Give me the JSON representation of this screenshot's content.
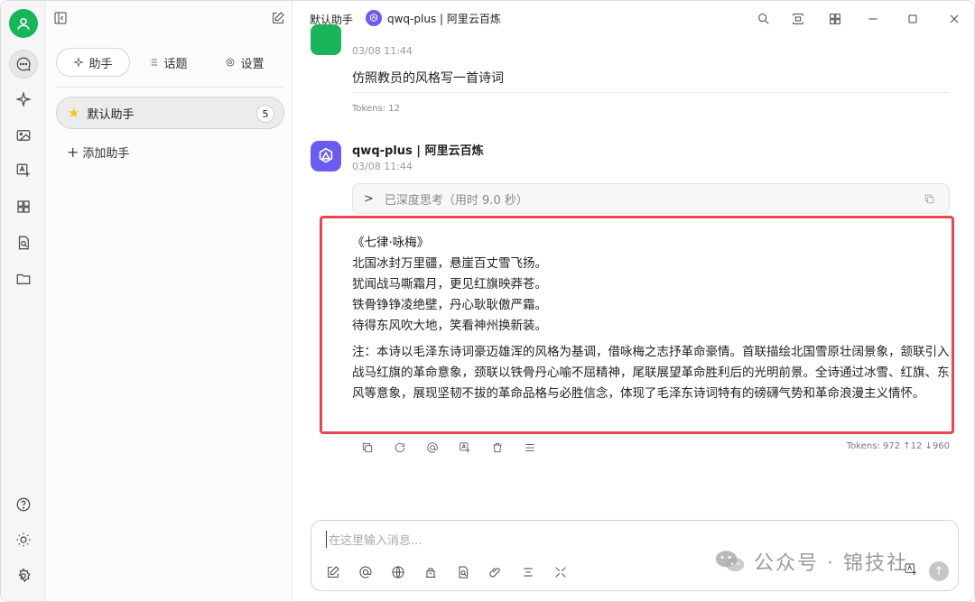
{
  "topbar": {
    "assistant_title": "默认助手",
    "model_name": "qwq-plus | 阿里云百炼"
  },
  "rail": {
    "icons": [
      "chat-icon",
      "sparkle-icon",
      "image-icon",
      "translate-icon",
      "apps-icon",
      "file-search-icon",
      "folder-icon",
      "help-icon",
      "theme-icon",
      "settings-icon"
    ]
  },
  "sidebar": {
    "tabs": [
      {
        "label": "助手"
      },
      {
        "label": "话题"
      },
      {
        "label": "设置"
      }
    ],
    "assistant": {
      "label": "默认助手",
      "count": "5"
    },
    "add_label": "添加助手"
  },
  "messages": {
    "user": {
      "time": "03/08 11:44",
      "text": "仿照教员的风格写一首诗词",
      "tokens": "Tokens: 12"
    },
    "bot": {
      "name": "qwq-plus | 阿里云百炼",
      "time": "03/08 11:44",
      "thinking": "已深度思考（用时 9.0 秒）",
      "poem": [
        "《七律·咏梅》",
        "北国冰封万里疆，悬崖百丈雪飞扬。",
        "犹闻战马嘶霜月，更见红旗映莽苍。",
        "铁骨铮铮凌绝壁，丹心耿耿傲严霜。",
        "待得东风吹大地，笑看神州换新装。"
      ],
      "note": "注：本诗以毛泽东诗词豪迈雄浑的风格为基调，借咏梅之志抒革命豪情。首联描绘北国雪原壮阔景象，颔联引入战马红旗的革命意象，颈联以铁骨丹心喻不屈精神，尾联展望革命胜利后的光明前景。全诗通过冰雪、红旗、东风等意象，展现坚韧不拔的革命品格与必胜信念，体现了毛泽东诗词特有的磅礴气势和革命浪漫主义情怀。",
      "tokens": "Tokens: 972 ↑12 ↓960"
    }
  },
  "input": {
    "placeholder": "在这里输入消息..."
  },
  "watermark": {
    "text": "公众号 · 锦技社"
  },
  "colors": {
    "accent_green": "#19b55a",
    "model_purple": "#6b5cf0",
    "highlight_red": "#e5484d"
  }
}
